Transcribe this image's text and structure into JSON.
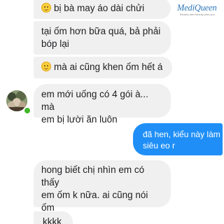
{
  "brand": {
    "name": "MediQueen",
    "tagline": "Beauty skin beauty plus you",
    "color": "#2f75b8"
  },
  "colors": {
    "incoming_bubble": "#f1f0f0",
    "outgoing_bubble": "#1f8ff7",
    "online_status": "#42b72a"
  },
  "conversation": {
    "messages": [
      {
        "from": "contact",
        "emoji": "smiling-face",
        "text": "bị bà may áo dài chửi"
      },
      {
        "from": "contact",
        "text_lines": [
          "tại ốm hơn bữa quá, bả phải",
          "bóp lại"
        ]
      },
      {
        "from": "contact",
        "emoji": "smiling-face",
        "text": "mà ai cũng khen ốm hết á"
      },
      {
        "from": "contact",
        "text_lines": [
          "em mới uống có 4 gói à... mà",
          "em bị lười ăn luôn"
        ]
      },
      {
        "from": "me",
        "text_lines": [
          "đã hen, kiểu này làm cô dâu",
          "siêu eo r"
        ]
      },
      {
        "from": "contact",
        "text_lines": [
          "hong biết chị nhìn em có thấy",
          "em ốm k nữa. ai cũng nói ốm",
          "á"
        ]
      },
      {
        "from": "contact",
        "text": "kkkk"
      }
    ]
  }
}
